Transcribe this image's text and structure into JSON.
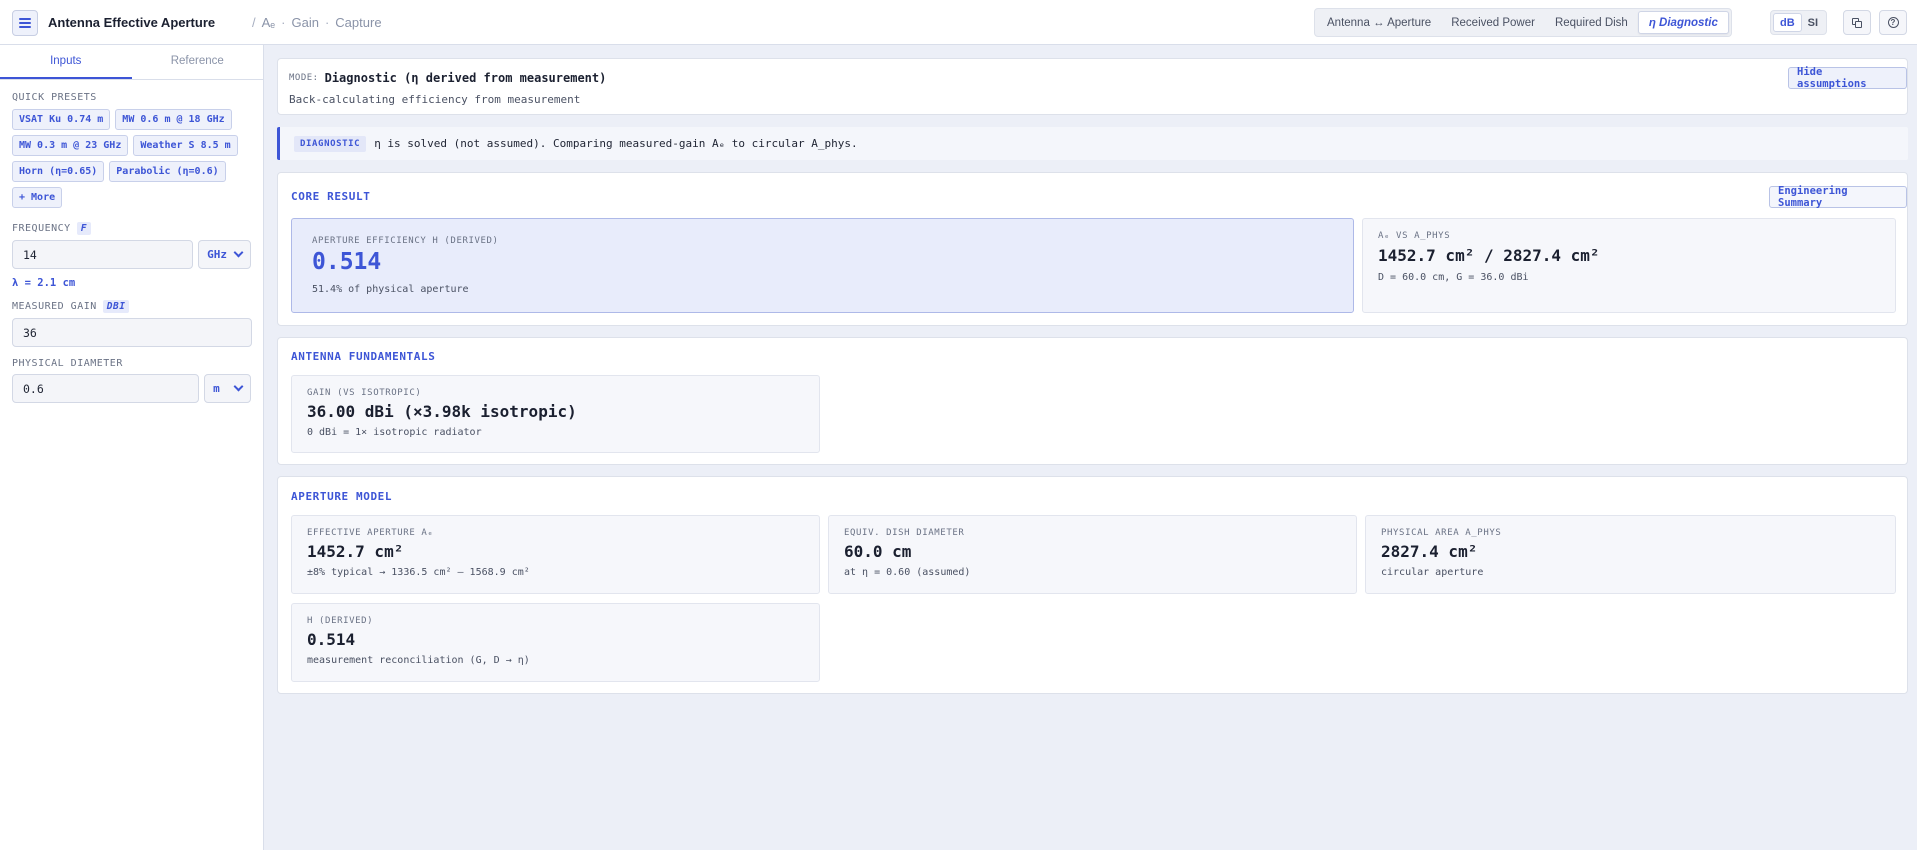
{
  "header": {
    "title": "Antenna Effective Aperture",
    "crumbs": [
      "Aₑ",
      "Gain",
      "Capture"
    ],
    "mode_tabs": [
      {
        "label": "Antenna ↔ Aperture"
      },
      {
        "label": "Received Power"
      },
      {
        "label": "Required Dish"
      },
      {
        "label": "η Diagnostic",
        "active": true
      }
    ],
    "units": [
      {
        "label": "dB",
        "active": true
      },
      {
        "label": "SI"
      }
    ],
    "copy_icon": "copy-icon",
    "help_icon": "help-icon"
  },
  "sidebar": {
    "tabs": [
      {
        "label": "Inputs",
        "active": true
      },
      {
        "label": "Reference"
      }
    ],
    "presets_label": "QUICK PRESETS",
    "presets": [
      "VSAT Ku 0.74 m",
      "MW 0.6 m @ 18 GHz",
      "MW 0.3 m @ 23 GHz",
      "Weather S 8.5 m",
      "Horn (η=0.65)",
      "Parabolic (η=0.6)",
      "+ More"
    ],
    "frequency": {
      "label": "FREQUENCY",
      "tag": "F",
      "value": "14",
      "unit": "GHz",
      "wavelength": "λ = 2.1 cm"
    },
    "gain": {
      "label": "MEASURED GAIN",
      "tag": "DBI",
      "value": "36"
    },
    "diameter": {
      "label": "PHYSICAL DIAMETER",
      "value": "0.6",
      "unit": "m"
    }
  },
  "mode": {
    "kicker": "MODE:",
    "title": "Diagnostic (η derived from measurement)",
    "subtitle": "Back-calculating efficiency from measurement",
    "hide_button": "Hide assumptions"
  },
  "diagnostic": {
    "badge": "DIAGNOSTIC",
    "text": "η is solved (not assumed). Comparing measured-gain Aₑ to circular A_phys."
  },
  "core": {
    "title": "CORE RESULT",
    "summary_button": "Engineering Summary",
    "efficiency": {
      "label": "APERTURE EFFICIENCY Η (DERIVED)",
      "value": "0.514",
      "sub": "51.4% of physical aperture"
    },
    "compare": {
      "label": "Aₑ VS A_PHYS",
      "value": "1452.7 cm² / 2827.4 cm²",
      "sub": "D = 60.0 cm, G = 36.0 dBi"
    }
  },
  "fundamentals": {
    "title": "ANTENNA FUNDAMENTALS",
    "gain": {
      "label": "GAIN (VS ISOTROPIC)",
      "value": "36.00 dBi (×3.98k isotropic)",
      "sub": "0 dBi = 1× isotropic radiator"
    }
  },
  "aperture": {
    "title": "APERTURE MODEL",
    "cards": [
      {
        "label": "EFFECTIVE APERTURE Aₑ",
        "value": "1452.7 cm²",
        "sub": "±8% typical → 1336.5 cm² – 1568.9 cm²"
      },
      {
        "label": "EQUIV. DISH DIAMETER",
        "value": "60.0 cm",
        "sub": "at η = 0.60 (assumed)"
      },
      {
        "label": "PHYSICAL AREA A_PHYS",
        "value": "2827.4 cm²",
        "sub": "circular aperture"
      },
      {
        "label": "Η (DERIVED)",
        "value": "0.514",
        "sub": "measurement reconciliation (G, D → η)"
      }
    ]
  }
}
